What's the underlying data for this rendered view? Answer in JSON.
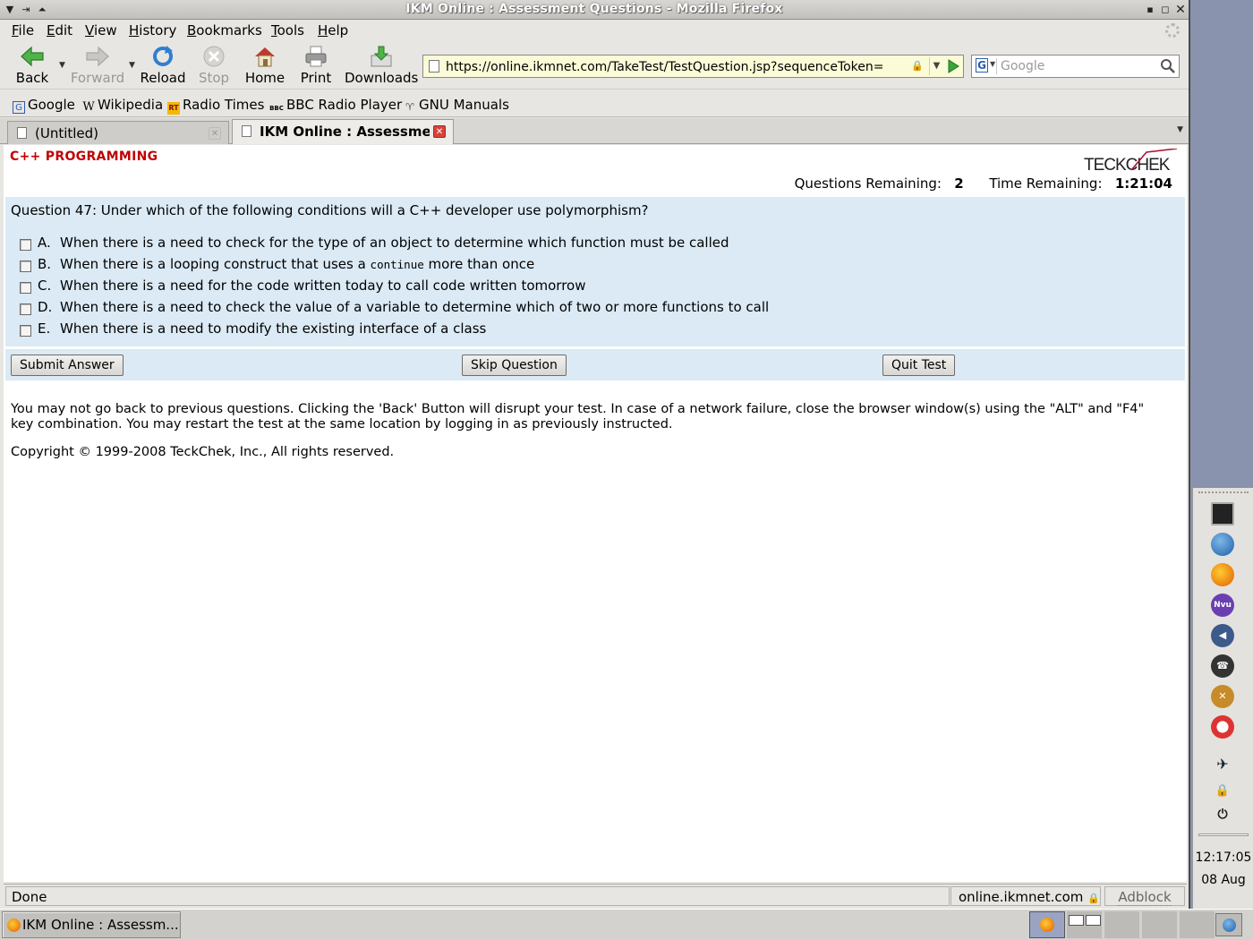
{
  "window": {
    "title": "IKM Online : Assessment Questions - Mozilla Firefox"
  },
  "menu": [
    "File",
    "Edit",
    "View",
    "History",
    "Bookmarks",
    "Tools",
    "Help"
  ],
  "nav": {
    "back": "Back",
    "forward": "Forward",
    "reload": "Reload",
    "stop": "Stop",
    "home": "Home",
    "print": "Print",
    "downloads": "Downloads"
  },
  "url": "https://online.ikmnet.com/TakeTest/TestQuestion.jsp?sequenceToken=",
  "search": {
    "placeholder": "Google"
  },
  "bookmarks": [
    "Google",
    "Wikipedia",
    "Radio Times",
    "BBC Radio Player",
    "GNU Manuals"
  ],
  "tabs": [
    {
      "label": "(Untitled)",
      "active": false
    },
    {
      "label": "IKM Online : Assessme...",
      "active": true
    }
  ],
  "page": {
    "subject": "C++ PROGRAMMING",
    "logo_text": "TECKCHEK",
    "questions_remaining_label": "Questions Remaining:",
    "questions_remaining": "2",
    "time_remaining_label": "Time Remaining:",
    "time_remaining": "1:21:04",
    "question": "Question 47: Under which of the following conditions will a C++ developer use polymorphism?",
    "options": [
      {
        "letter": "A.",
        "text": "When there is a need to check for the type of an object to determine which function must be called"
      },
      {
        "letter": "B.",
        "text_before": "When there is a looping construct that uses a",
        "code": "continue",
        "text_after": "more than once"
      },
      {
        "letter": "C.",
        "text": "When there is a need for the code written today to call code written tomorrow"
      },
      {
        "letter": "D.",
        "text": "When there is a need to check the value of a variable to determine which of two or more functions to call"
      },
      {
        "letter": "E.",
        "text": "When there is a need to modify the existing interface of a class"
      }
    ],
    "buttons": {
      "submit": "Submit Answer",
      "skip": "Skip Question",
      "quit": "Quit Test"
    },
    "notice": "You may not go back to previous questions. Clicking the 'Back' Button will disrupt your test. In case of a network failure, close the browser window(s) using the \"ALT\" and \"F4\" key combination. You may restart the test at the same location by logging in as previously instructed.",
    "copyright": "Copyright © 1999-2008 TeckChek, Inc., All rights reserved."
  },
  "status": {
    "text": "Done",
    "host": "online.ikmnet.com",
    "adblock": "Adblock"
  },
  "dock": {
    "time": "12:17:05",
    "date": "08 Aug"
  },
  "taskbar": {
    "firefox_task": "IKM Online : Assessm..."
  }
}
